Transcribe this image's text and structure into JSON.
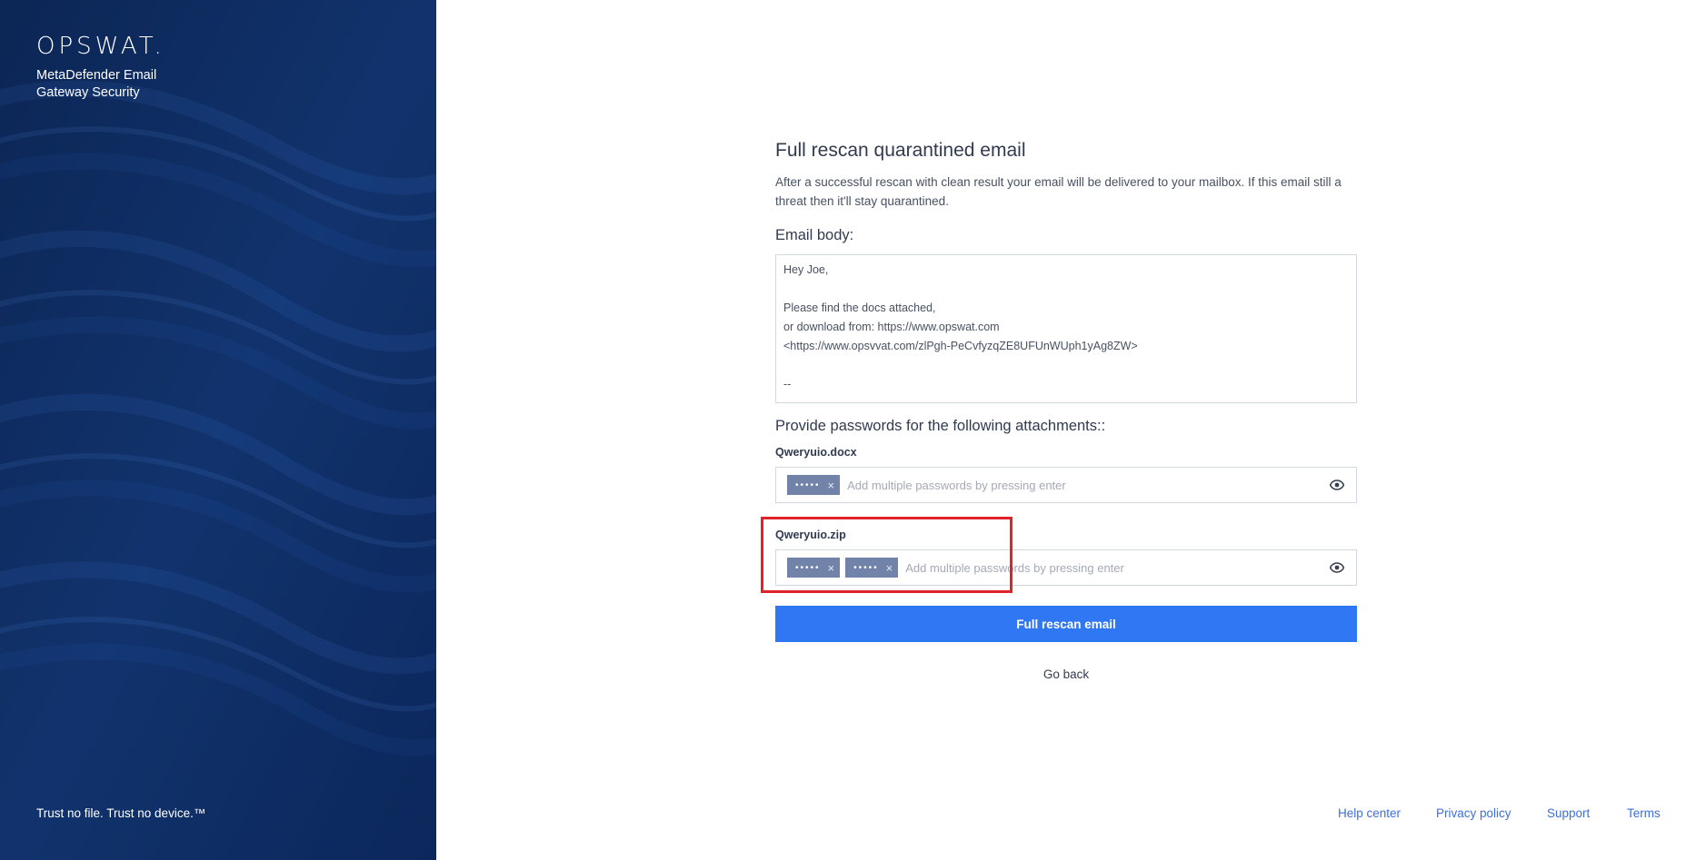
{
  "brand": {
    "logo": "OPSWAT.",
    "product": "MetaDefender Email Gateway Security",
    "tagline": "Trust no file. Trust no device.™",
    "panel_color": "#0c2a5e"
  },
  "main": {
    "title": "Full rescan quarantined email",
    "description": "After a successful rescan with clean result your email will be delivered to your mailbox. If this email still a threat then it'll stay quarantined.",
    "email_body_label": "Email body:",
    "email_body": "Hey Joe,\n\nPlease find the docs attached,\nor download from: https://www.opswat.com\n<https://www.opsvvat.com/zlPgh-PeCvfyzqZE8UFUnWUph1yAg8ZW>\n\n--",
    "passwords_label": "Provide passwords for the following attachments::",
    "attachments": [
      {
        "name": "Qweryuio.docx",
        "chips": [
          "•••••"
        ],
        "placeholder": "Add multiple passwords by pressing enter",
        "toggle_icon": "eye-icon"
      },
      {
        "name": "Qweryuio.zip",
        "chips": [
          "•••••",
          "•••••"
        ],
        "placeholder": "Add multiple passwords by pressing enter",
        "toggle_icon": "eye-icon"
      }
    ],
    "chip_remove": "×",
    "submit_label": "Full rescan email",
    "back_label": "Go back",
    "accent_color": "#3077f3"
  },
  "footer": {
    "links": [
      "Help center",
      "Privacy policy",
      "Support",
      "Terms"
    ]
  },
  "annotation": {
    "highlight_color": "#e0232b"
  }
}
